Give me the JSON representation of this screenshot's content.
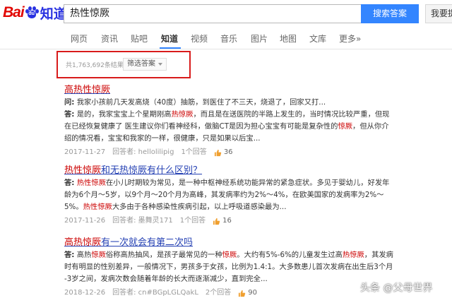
{
  "header": {
    "logo_text_bai": "Bai",
    "logo_text_du": "du",
    "logo_text_zhidao": "知道",
    "search_value": "热性惊厥",
    "search_button_label": "搜索答案",
    "answer_button_label": "我要提问"
  },
  "nav": {
    "items": [
      "网页",
      "资讯",
      "贴吧",
      "知道",
      "视频",
      "音乐",
      "图片",
      "地图",
      "文库",
      "更多»"
    ],
    "active": "知道"
  },
  "filter": {
    "result_count": "共1,763,692条结果",
    "filter_label": "筛选答案"
  },
  "results": [
    {
      "title_pre": "",
      "title_em": "高热性惊厥",
      "title_post": "",
      "question_label": "问:",
      "question_text": "我家小孩前几天发高烧（40度）抽筋，到医住了不三天，烧退了，回家又打...",
      "answer_label": "答:",
      "answer_line1_pre": "是的，我家宝宝上个星期刚高",
      "answer_line1_em": "热惊厥",
      "answer_line1_post": "，而且是在送医院的半路上发生的，当时情况比较严重，但现",
      "answer_line2_pre": "在已经恢复健康了 医生建议你们看神经科，做脑CT是因为担心宝宝有可能是复杂性的",
      "answer_line2_em": "惊厥",
      "answer_line2_post": "，但从你介",
      "answer_line3": "绍的情况看，宝宝和我家的一样，很健康，只是如果以后宝...",
      "date": "2017-11-27",
      "answerer": "回答者: hellolilipig",
      "answer_count": "1个回答",
      "likes": "36"
    },
    {
      "title_pre": "",
      "title_em": "热性惊厥",
      "title_post": "和无热惊厥有什么区别？",
      "answer_label": "答:",
      "answer_line1_pre": "",
      "answer_line1_em": "热性惊厥",
      "answer_line1_post": "在小儿时期较为常见，是一种中枢神经系统功能异常的紧急症状。多见于婴幼儿，好发年",
      "answer_line2_pre": "龄为6个月～5岁，以9个月～20个月为高峰，其发病率约为2%～4%，在欧美国家的发病率为2%～",
      "answer_line2_em": "",
      "answer_line2_post": "",
      "answer_line3_pre": "5%。",
      "answer_line3_em": "热性惊厥",
      "answer_line3_post": "大多由于各种感染性疾病引起，以上呼吸道感染最为...",
      "date": "2017-11-26",
      "answerer": "回答者: 墨舞灵171",
      "answer_count": "1个回答",
      "likes": "16"
    },
    {
      "title_pre": "",
      "title_em": "高热惊厥",
      "title_post": "有一次就会有第二次吗",
      "answer_label": "答:",
      "answer_line1_pre": "高热",
      "answer_line1_em": "惊厥",
      "answer_line1_mid": "俗称高热抽风，是孩子最常见的一种",
      "answer_line1_em2": "惊厥",
      "answer_line1_post": "。大约有5%-6%的儿童发生过高",
      "answer_line1_em3": "热惊厥",
      "answer_line1_tail": "，其发病",
      "answer_line2": "时有明显的性别差异，一般情况下，男孩多于女孩，比例为1.4:1。大多数患儿首次发病在出生后3个月",
      "answer_line3": "-3岁之间，发病次数会随着年龄的长大而逐渐减少，直到完全...",
      "date": "2018-12-26",
      "answerer": "回答者: cn#BGpLGLQakL",
      "answer_count": "2个回答",
      "likes": "90"
    }
  ],
  "watermark": "头条 @父母世界",
  "colors": {
    "brand_red": "#e10602",
    "brand_blue": "#2932e1",
    "search_button": "#3385ff",
    "link": "#2440b3",
    "highlight": "#cc0000",
    "annotation_box": "#d81b1b"
  }
}
